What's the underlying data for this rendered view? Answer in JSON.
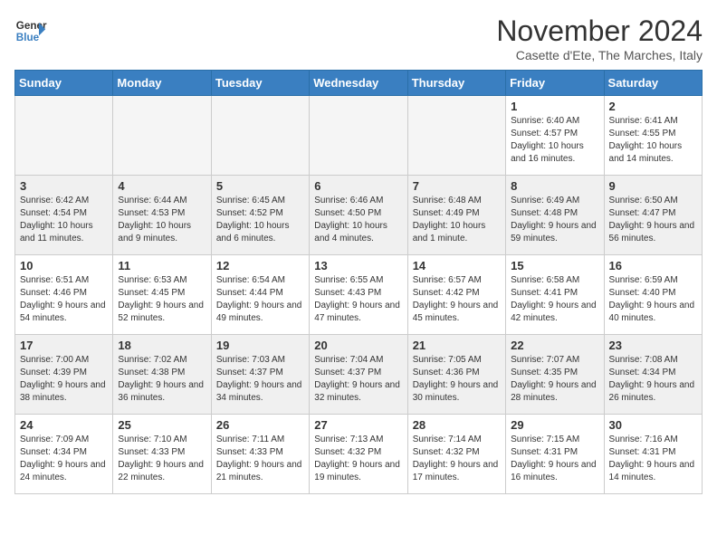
{
  "logo": {
    "line1": "General",
    "line2": "Blue"
  },
  "title": "November 2024",
  "location": "Casette d'Ete, The Marches, Italy",
  "headers": [
    "Sunday",
    "Monday",
    "Tuesday",
    "Wednesday",
    "Thursday",
    "Friday",
    "Saturday"
  ],
  "weeks": [
    [
      {
        "day": "",
        "info": "",
        "empty": true
      },
      {
        "day": "",
        "info": "",
        "empty": true
      },
      {
        "day": "",
        "info": "",
        "empty": true
      },
      {
        "day": "",
        "info": "",
        "empty": true
      },
      {
        "day": "",
        "info": "",
        "empty": true
      },
      {
        "day": "1",
        "info": "Sunrise: 6:40 AM\nSunset: 4:57 PM\nDaylight: 10 hours and 16 minutes."
      },
      {
        "day": "2",
        "info": "Sunrise: 6:41 AM\nSunset: 4:55 PM\nDaylight: 10 hours and 14 minutes."
      }
    ],
    [
      {
        "day": "3",
        "info": "Sunrise: 6:42 AM\nSunset: 4:54 PM\nDaylight: 10 hours and 11 minutes."
      },
      {
        "day": "4",
        "info": "Sunrise: 6:44 AM\nSunset: 4:53 PM\nDaylight: 10 hours and 9 minutes."
      },
      {
        "day": "5",
        "info": "Sunrise: 6:45 AM\nSunset: 4:52 PM\nDaylight: 10 hours and 6 minutes."
      },
      {
        "day": "6",
        "info": "Sunrise: 6:46 AM\nSunset: 4:50 PM\nDaylight: 10 hours and 4 minutes."
      },
      {
        "day": "7",
        "info": "Sunrise: 6:48 AM\nSunset: 4:49 PM\nDaylight: 10 hours and 1 minute."
      },
      {
        "day": "8",
        "info": "Sunrise: 6:49 AM\nSunset: 4:48 PM\nDaylight: 9 hours and 59 minutes."
      },
      {
        "day": "9",
        "info": "Sunrise: 6:50 AM\nSunset: 4:47 PM\nDaylight: 9 hours and 56 minutes."
      }
    ],
    [
      {
        "day": "10",
        "info": "Sunrise: 6:51 AM\nSunset: 4:46 PM\nDaylight: 9 hours and 54 minutes."
      },
      {
        "day": "11",
        "info": "Sunrise: 6:53 AM\nSunset: 4:45 PM\nDaylight: 9 hours and 52 minutes."
      },
      {
        "day": "12",
        "info": "Sunrise: 6:54 AM\nSunset: 4:44 PM\nDaylight: 9 hours and 49 minutes."
      },
      {
        "day": "13",
        "info": "Sunrise: 6:55 AM\nSunset: 4:43 PM\nDaylight: 9 hours and 47 minutes."
      },
      {
        "day": "14",
        "info": "Sunrise: 6:57 AM\nSunset: 4:42 PM\nDaylight: 9 hours and 45 minutes."
      },
      {
        "day": "15",
        "info": "Sunrise: 6:58 AM\nSunset: 4:41 PM\nDaylight: 9 hours and 42 minutes."
      },
      {
        "day": "16",
        "info": "Sunrise: 6:59 AM\nSunset: 4:40 PM\nDaylight: 9 hours and 40 minutes."
      }
    ],
    [
      {
        "day": "17",
        "info": "Sunrise: 7:00 AM\nSunset: 4:39 PM\nDaylight: 9 hours and 38 minutes."
      },
      {
        "day": "18",
        "info": "Sunrise: 7:02 AM\nSunset: 4:38 PM\nDaylight: 9 hours and 36 minutes."
      },
      {
        "day": "19",
        "info": "Sunrise: 7:03 AM\nSunset: 4:37 PM\nDaylight: 9 hours and 34 minutes."
      },
      {
        "day": "20",
        "info": "Sunrise: 7:04 AM\nSunset: 4:37 PM\nDaylight: 9 hours and 32 minutes."
      },
      {
        "day": "21",
        "info": "Sunrise: 7:05 AM\nSunset: 4:36 PM\nDaylight: 9 hours and 30 minutes."
      },
      {
        "day": "22",
        "info": "Sunrise: 7:07 AM\nSunset: 4:35 PM\nDaylight: 9 hours and 28 minutes."
      },
      {
        "day": "23",
        "info": "Sunrise: 7:08 AM\nSunset: 4:34 PM\nDaylight: 9 hours and 26 minutes."
      }
    ],
    [
      {
        "day": "24",
        "info": "Sunrise: 7:09 AM\nSunset: 4:34 PM\nDaylight: 9 hours and 24 minutes."
      },
      {
        "day": "25",
        "info": "Sunrise: 7:10 AM\nSunset: 4:33 PM\nDaylight: 9 hours and 22 minutes."
      },
      {
        "day": "26",
        "info": "Sunrise: 7:11 AM\nSunset: 4:33 PM\nDaylight: 9 hours and 21 minutes."
      },
      {
        "day": "27",
        "info": "Sunrise: 7:13 AM\nSunset: 4:32 PM\nDaylight: 9 hours and 19 minutes."
      },
      {
        "day": "28",
        "info": "Sunrise: 7:14 AM\nSunset: 4:32 PM\nDaylight: 9 hours and 17 minutes."
      },
      {
        "day": "29",
        "info": "Sunrise: 7:15 AM\nSunset: 4:31 PM\nDaylight: 9 hours and 16 minutes."
      },
      {
        "day": "30",
        "info": "Sunrise: 7:16 AM\nSunset: 4:31 PM\nDaylight: 9 hours and 14 minutes."
      }
    ]
  ]
}
